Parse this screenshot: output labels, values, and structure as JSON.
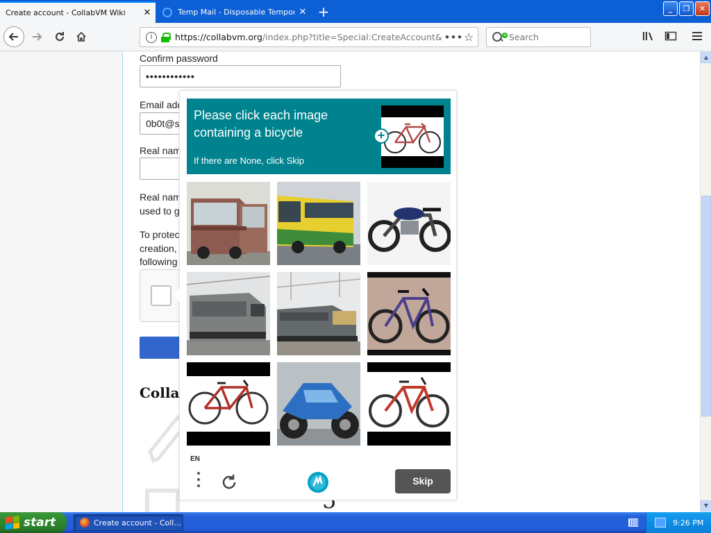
{
  "browser": {
    "tabs": [
      {
        "title": "Create account - CollabVM Wiki",
        "active": true
      },
      {
        "title": "Temp Mail - Disposable Temporary E",
        "active": false
      }
    ],
    "url_host": "https://collabvm.org",
    "url_rest": "/index.php?title=Special:CreateAccount&",
    "search_placeholder": "Search",
    "window_minimize": "_",
    "window_restore": "❐",
    "window_close": "✕",
    "new_tab": "+",
    "page_actions": "•••",
    "star": "☆"
  },
  "form": {
    "confirm_password_label": "Confirm password",
    "confirm_password_value": "••••••••••••",
    "email_label": "Email add",
    "email_value": "0b0t@s",
    "real_name_label": "Real nam",
    "real_name_help_1": "Real nam",
    "real_name_help_2": "used to g",
    "protect_1": "To protec",
    "protect_2": "creation,",
    "protect_3": "following",
    "heading": "Colla",
    "bg_glyph": "5"
  },
  "captcha": {
    "prompt": "Please click each image containing a bicycle",
    "sub_prompt": "If there are None, click Skip",
    "language": "EN",
    "skip_label": "Skip",
    "example_icon": "plus-icon",
    "tiles": [
      "bus",
      "bus",
      "motorcycle",
      "train",
      "train",
      "bicycle",
      "bicycle",
      "motorcycle",
      "bicycle"
    ]
  },
  "taskbar": {
    "start_label": "start",
    "task_label": "Create account - Coll...",
    "clock": "9:26 PM"
  },
  "colors": {
    "captcha_teal": "#00838f",
    "skip_button": "#555555",
    "xp_blue": "#245edb",
    "start_green": "#2f8b2f",
    "firefox_titlebar": "#0c5fd5"
  }
}
